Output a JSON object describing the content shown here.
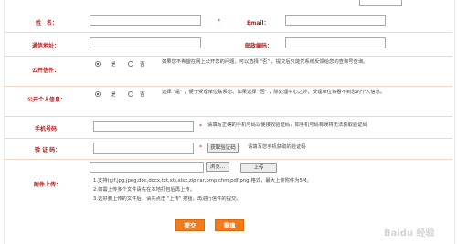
{
  "form": {
    "name_label": "姓　名：",
    "email_label": "Email：",
    "address_label": "通信地址：",
    "postcode_label": "邮政编码：",
    "required_mark": "*",
    "public_letter": {
      "label": "公开信件：",
      "yes": "是",
      "no": "否",
      "hint": "如果您不希望在网上公开您的问题，可以选择 \"否\" ，提交后只能凭系统反馈给您的查询号查询。"
    },
    "public_info": {
      "label": "公开个人信息：",
      "yes": "是",
      "no": "否",
      "hint": "选择 \"是\" ，便于受理单位联系您。如果选择 \"否\" ，除处理中心之外，受理单位将看不到您的个人信息。"
    },
    "phone": {
      "label": "手机号码：",
      "hint": "请填写正确的手机号码以便接收验证码，如手机号码有误将无法获取验证码"
    },
    "captcha": {
      "label": "验 证 码：",
      "get_button": "获取验证码",
      "hint": "请填写您手机获取的验证码"
    },
    "attachment": {
      "label": "附件上传：",
      "browse_button": "浏览...",
      "upload_button": "上传",
      "notes": [
        "1.支持(gif,jpg,jpeg,doc,docx,txt,xls,xlsx,zip,rar,bmp,chm,pdf,png)格式，最大上传附件为5M。",
        "2.如需上传多个文件请先在本地打包后再上传。",
        "3.选好要上传的文件后，请先点击 \"上传\" 按钮，再进行信件的提交。"
      ]
    },
    "submit_button": "提交",
    "reset_button": "重填"
  },
  "watermark": "Baidu 经验",
  "colors": {
    "label": "#b81c1c",
    "accent": "#ef7d1e"
  }
}
